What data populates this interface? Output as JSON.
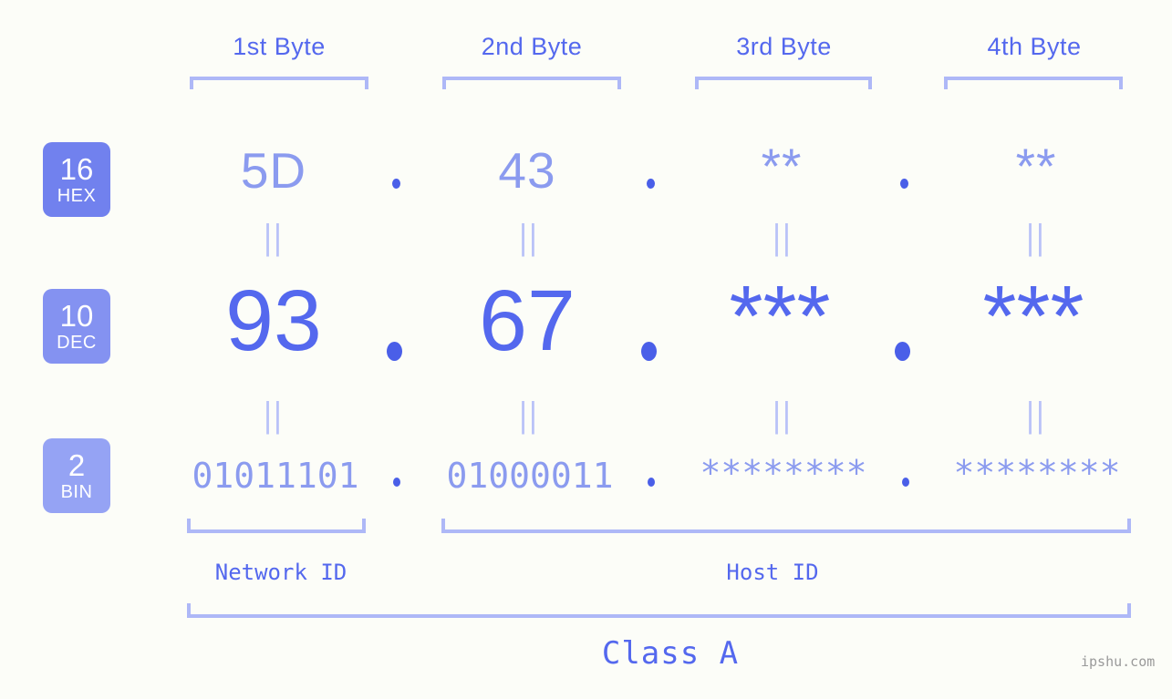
{
  "meta": {
    "background_color": "#fcfdf8",
    "accent_color": "#5468ee",
    "muted_color": "#8b9bef",
    "bracket_color": "#aeb8f7"
  },
  "byte_headers": [
    {
      "label": "1st Byte"
    },
    {
      "label": "2nd Byte"
    },
    {
      "label": "3rd Byte"
    },
    {
      "label": "4th Byte"
    }
  ],
  "bases": [
    {
      "number": "16",
      "abbr": "HEX",
      "color": "#7181ee"
    },
    {
      "number": "10",
      "abbr": "DEC",
      "color": "#8492f1"
    },
    {
      "number": "2",
      "abbr": "BIN",
      "color": "#95a3f4"
    }
  ],
  "rows": {
    "hex": {
      "values": [
        "5D",
        "43",
        "**",
        "**"
      ]
    },
    "dec": {
      "values": [
        "93",
        "67",
        "***",
        "***"
      ]
    },
    "bin": {
      "values": [
        "01011101",
        "01000011",
        "********",
        "********"
      ]
    }
  },
  "equals_mark": "||",
  "separator": ".",
  "segments": [
    {
      "label": "Network ID"
    },
    {
      "label": "Host ID"
    }
  ],
  "class": {
    "label": "Class A"
  },
  "watermark": {
    "text": "ipshu.com"
  }
}
